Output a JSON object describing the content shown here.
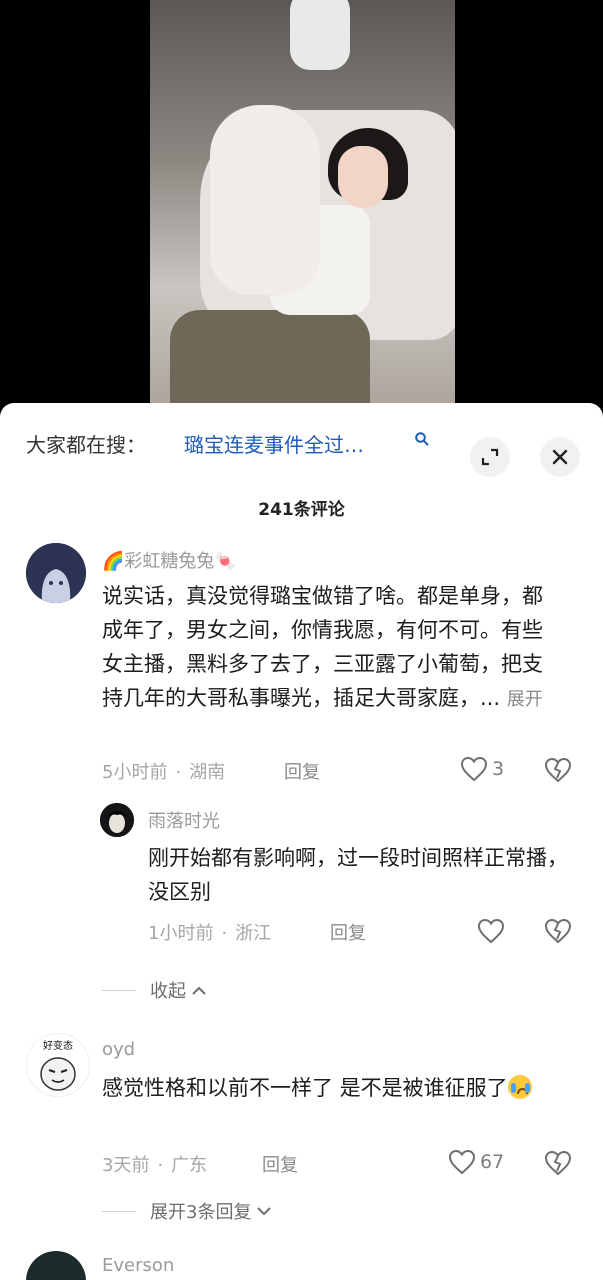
{
  "search": {
    "prefix": "大家都在搜：",
    "query": "璐宝连麦事件全过…"
  },
  "comment_count_label": "241条评论",
  "comments": [
    {
      "username": "🌈彩虹糖兔兔🍬",
      "text": "说实话，真没觉得璐宝做错了啥。都是单身，都成年了，男女之间，你情我愿，有何不可。有些女主播，黑料多了去了，三亚露了小葡萄，把支持几年的大哥私事曝光，插足大哥家庭，...",
      "expand_label": "展开",
      "time": "5小时前",
      "location": "湖南",
      "reply_label": "回复",
      "likes": "3"
    },
    {
      "username": "oyd",
      "text": "感觉性格和以前不一样了 是不是被谁征服了",
      "time": "3天前",
      "location": "广东",
      "reply_label": "回复",
      "likes": "67"
    },
    {
      "username": "Everson"
    }
  ],
  "reply": {
    "username": "雨落时光",
    "text": "刚开始都有影响啊，过一段时间照样正常播，没区别",
    "time": "1小时前",
    "location": "浙江",
    "reply_label": "回复"
  },
  "collapse_label": "收起",
  "more_replies_label": "展开3条回复",
  "avatar_badge_text": "好变态"
}
